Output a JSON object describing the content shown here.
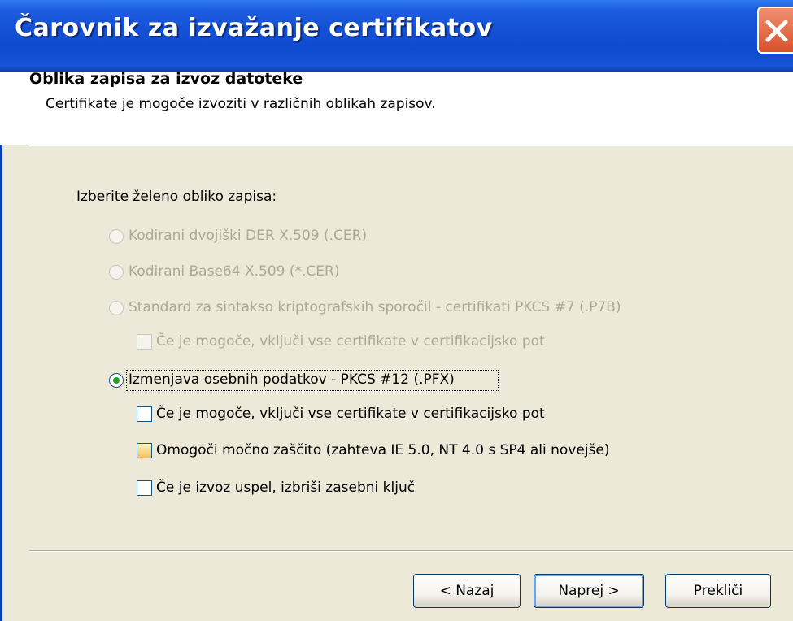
{
  "window": {
    "title": "Čarovnik za izvažanje certifikatov"
  },
  "header": {
    "title": "Oblika zapisa za izvoz datoteke",
    "subtitle": "Certifikate je mogoče izvoziti v različnih oblikah zapisov."
  },
  "prompt": "Izberite želeno obliko zapisa:",
  "options": [
    {
      "label": "Kodirani dvojiški DER X.509 (.CER)",
      "enabled": false,
      "selected": false
    },
    {
      "label": "Kodirani Base64 X.509 (*.CER)",
      "enabled": false,
      "selected": false
    },
    {
      "label": "Standard za sintakso kriptografskih sporočil - certifikati PKCS #7  (.P7B)",
      "enabled": false,
      "selected": false
    },
    {
      "label": "Izmenjava osebnih podatkov - PKCS #12 (.PFX)",
      "enabled": true,
      "selected": true
    }
  ],
  "p7b_checkbox": {
    "label": "Če je mogoče, vključi vse certifikate v certifikacijsko pot",
    "enabled": false,
    "checked": false
  },
  "pfx_checkboxes": [
    {
      "label": "Če je mogoče, vključi vse certifikate v certifikacijsko pot",
      "checked": false
    },
    {
      "label": "Omogoči močno zaščito (zahteva IE 5.0, NT 4.0 s SP4 ali novejše)",
      "checked": false
    },
    {
      "label": "Če je izvoz uspel, izbriši zasebni ključ",
      "checked": false
    }
  ],
  "buttons": {
    "back": "< Nazaj",
    "next": "Naprej >",
    "cancel": "Prekliči"
  },
  "colors": {
    "titlebar": "#0e4ad0",
    "radio_selected": "#21a121",
    "disabled_text": "#aca899"
  }
}
